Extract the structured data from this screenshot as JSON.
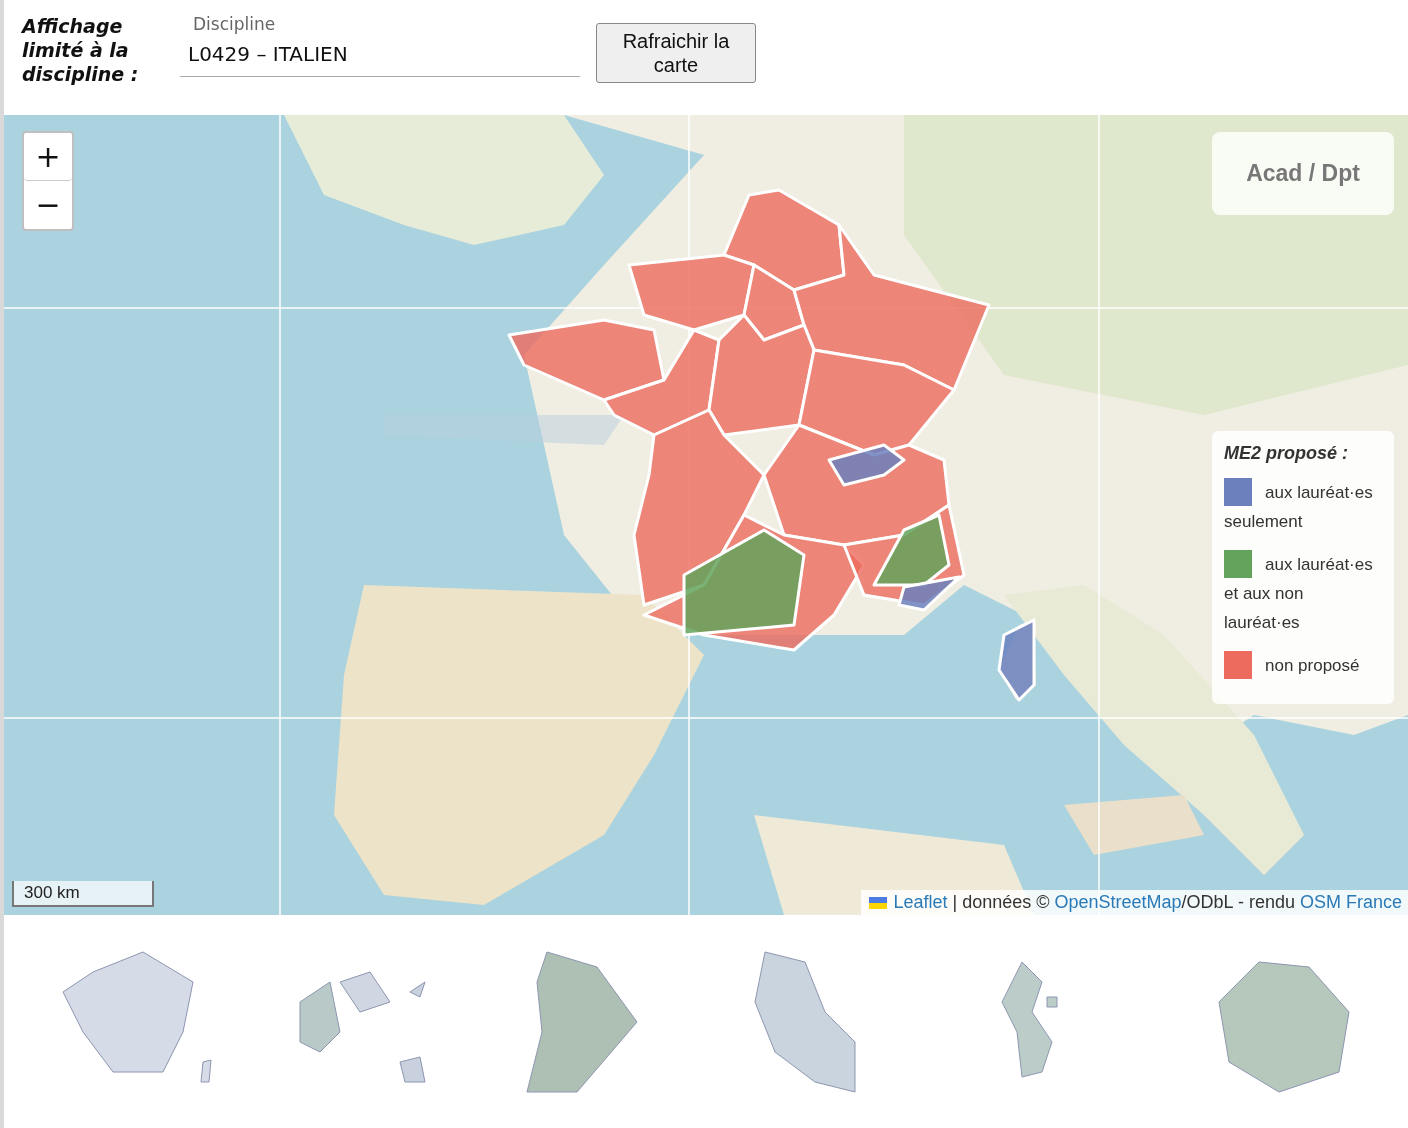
{
  "header": {
    "label": "Affichage limité à la discipline :",
    "field": {
      "label": "Discipline",
      "value": "L0429 – ITALIEN"
    },
    "button": "Rafraichir la carte"
  },
  "map": {
    "zoom_controls": [
      "+",
      "−"
    ],
    "layer_title": "Acad / Dpt",
    "legend": {
      "title": "ME2 proposé :",
      "items": [
        {
          "label": "aux lauréat·es seulement",
          "color": "#6b80bd"
        },
        {
          "label": "aux lauréat·es et aux non lauréat·es",
          "color": "#63a35c"
        },
        {
          "label": "non proposé",
          "color": "#ec6a5e"
        }
      ]
    },
    "scale": "300 km",
    "attribution": [
      {
        "kind": "link",
        "text": "Leaflet"
      },
      {
        "kind": "text",
        "text": " | données © "
      },
      {
        "kind": "link",
        "text": "OpenStreetMap"
      },
      {
        "kind": "text",
        "text": "/ODbL - rendu "
      },
      {
        "kind": "link",
        "text": "OSM France"
      }
    ]
  },
  "territories": [
    {
      "kind": "metropole"
    },
    {
      "kind": "guadeloupe"
    },
    {
      "kind": "guyane"
    },
    {
      "kind": "martinique"
    },
    {
      "kind": "mayotte"
    },
    {
      "kind": "reunion"
    }
  ]
}
